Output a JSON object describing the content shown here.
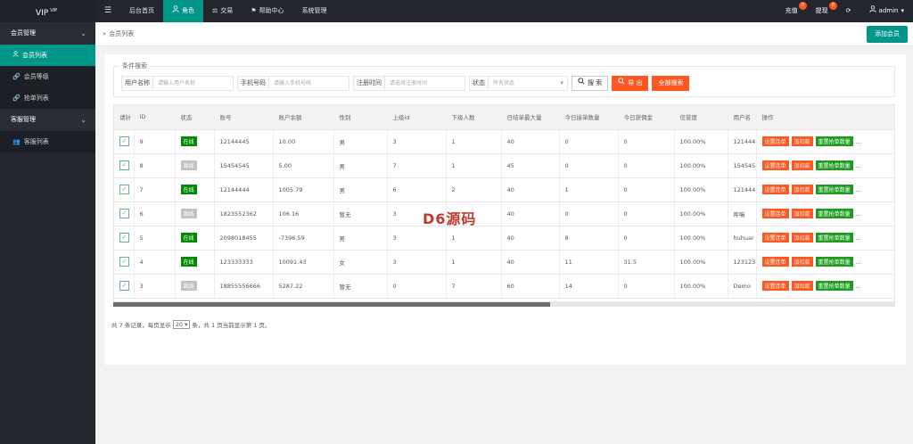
{
  "app": {
    "logo": "VIP",
    "logo_sup": "VIP"
  },
  "topnav": {
    "menu_toggle": "☰",
    "items": [
      {
        "label": "后台首页",
        "icon": ""
      },
      {
        "label": "角色",
        "icon": "user-icon"
      },
      {
        "label": "交易",
        "icon": "scale-icon"
      },
      {
        "label": "帮助中心",
        "icon": "flag-icon"
      },
      {
        "label": "系统管理",
        "icon": ""
      }
    ],
    "recharge": {
      "label": "充值",
      "badge": "0"
    },
    "withdraw": {
      "label": "提现",
      "badge": "0"
    },
    "refresh_icon": "⟳",
    "user": "admin"
  },
  "sidebar": {
    "groups": [
      {
        "label": "会员管理",
        "items": [
          "会员列表",
          "会员等级",
          "抢单列表"
        ]
      },
      {
        "label": "客服管理",
        "items": [
          "客服列表"
        ]
      }
    ]
  },
  "breadcrumb": {
    "sep": "»",
    "current": "会员列表"
  },
  "add_button": "添加会员",
  "search": {
    "legend": "条件搜索",
    "username_label": "用户名称",
    "username_placeholder": "请输入用户名称",
    "phone_label": "手机号码",
    "phone_placeholder": "请输入手机号码",
    "regtime_label": "注册时间",
    "regtime_placeholder": "请选择注册时间",
    "status_label": "状态",
    "status_value": "所有状态",
    "search_btn": "搜 索",
    "export_btn": "导 出",
    "reset_btn": "全部搜索"
  },
  "table": {
    "headers": [
      "请针",
      "ID",
      "状态",
      "账号",
      "账户余额",
      "性别",
      "上级id",
      "下级人数",
      "日结单最大量",
      "今日接单数量",
      "今日获佣金",
      "信誉度",
      "用户名",
      "操作"
    ],
    "rows": [
      {
        "id": "9",
        "status": "在线",
        "online": true,
        "account": "12144445",
        "balance": "10.00",
        "gender": "男",
        "parent": "3",
        "subs": "1",
        "max": "40",
        "today": "0",
        "comm": "0",
        "credit": "100.00%",
        "name": "121444"
      },
      {
        "id": "8",
        "status": "离线",
        "online": false,
        "account": "15454545",
        "balance": "5.00",
        "gender": "男",
        "parent": "7",
        "subs": "1",
        "max": "45",
        "today": "0",
        "comm": "0",
        "credit": "100.00%",
        "name": "154545"
      },
      {
        "id": "7",
        "status": "在线",
        "online": true,
        "account": "12144444",
        "balance": "1005.79",
        "gender": "男",
        "parent": "6",
        "subs": "2",
        "max": "40",
        "today": "1",
        "comm": "0",
        "credit": "100.00%",
        "name": "121444"
      },
      {
        "id": "6",
        "status": "离线",
        "online": false,
        "account": "1823552362",
        "balance": "106.16",
        "gender": "暂无",
        "parent": "3",
        "subs": "",
        "max": "40",
        "today": "0",
        "comm": "0",
        "credit": "100.00%",
        "name": "呼嘛"
      },
      {
        "id": "5",
        "status": "在线",
        "online": true,
        "account": "2098018455",
        "balance": "-7396.59",
        "gender": "男",
        "parent": "3",
        "subs": "1",
        "max": "40",
        "today": "8",
        "comm": "0",
        "credit": "100.00%",
        "name": "huhuar"
      },
      {
        "id": "4",
        "status": "在线",
        "online": true,
        "account": "123333333",
        "balance": "10091.43",
        "gender": "女",
        "parent": "3",
        "subs": "1",
        "max": "40",
        "today": "11",
        "comm": "31.5",
        "credit": "100.00%",
        "name": "123123"
      },
      {
        "id": "3",
        "status": "离线",
        "online": false,
        "account": "18855556666",
        "balance": "5287.22",
        "gender": "暂无",
        "parent": "0",
        "subs": "7",
        "max": "60",
        "today": "14",
        "comm": "0",
        "credit": "100.00%",
        "name": "Demo"
      }
    ],
    "actions": {
      "a1": "设置连单",
      "a2": "加扣款",
      "a3": "重置抢单数量",
      "more": "..."
    }
  },
  "pager": {
    "p1": "共 7 条记录，每页显示",
    "size": "20",
    "p2": "条，共 1 页当前显示第 1 页。"
  },
  "watermark": "D6源码"
}
